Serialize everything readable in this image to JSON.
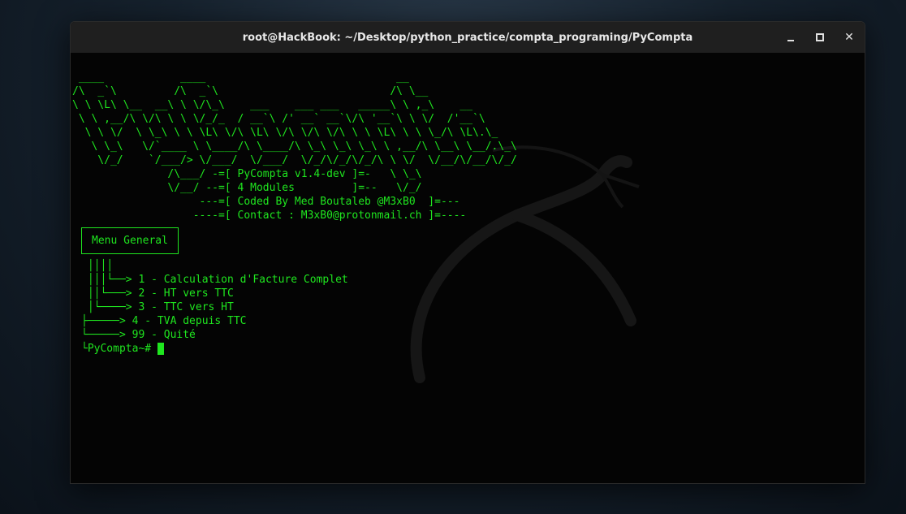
{
  "window": {
    "title": "root@HackBook: ~/Desktop/python_practice/compta_programing/PyCompta",
    "close_glyph": "✕"
  },
  "terminal": {
    "banner": " ____            ____                              __\n/\\  _`\\         /\\  _`\\                           /\\ \\__\n\\ \\ \\L\\ \\__  __\\ \\ \\/\\_\\    ___    ___ ___   _____\\ \\ ,_\\    __\n \\ \\ ,__/\\ \\/\\ \\ \\ \\/_/_  / __`\\ /' __` __`\\/\\ '__`\\ \\ \\/  /'__`\\\n  \\ \\ \\/  \\ \\_\\ \\ \\ \\L\\ \\/\\ \\L\\ \\/\\ \\/\\ \\/\\ \\ \\ \\L\\ \\ \\ \\_/\\ \\L\\.\\_\n   \\ \\_\\   \\/`____ \\ \\____/\\ \\____/\\ \\_\\ \\_\\ \\_\\ \\ ,__/\\ \\__\\ \\__/.\\_\\\n    \\/_/    `/___/> \\/___/  \\/___/  \\/_/\\/_/\\/_/\\ \\ \\/  \\/__/\\/__/\\/_/\n               /\\___/ -=[ PyCompta v1.4-dev ]=-   \\ \\_\\\n               \\/__/ --=[ 4 Modules         ]=--   \\/_/\n                    ---=[ Coded By Med Boutaleb @M3xB0  ]=---\n                   ----=[ Contact : M3xB0@protonmail.ch ]=----",
    "menu_title": "Menu General",
    "menu_tree": " ││││\n │││└──> 1 - Calculation d'Facture Complet\n ││└───> 2 - HT vers TTC\n │└────> 3 - TTC vers HT\n├─────> 4 - TVA depuis TTC\n└─────> 99 - Quité",
    "prompt_branch": "└",
    "prompt": "PyCompta~#"
  },
  "colors": {
    "terminal_text": "#1fe61f",
    "terminal_bg": "#040404",
    "titlebar_bg": "#1f1f1f"
  },
  "icons": [
    "minimize-icon",
    "maximize-icon",
    "close-icon",
    "kali-dragon-watermark"
  ]
}
